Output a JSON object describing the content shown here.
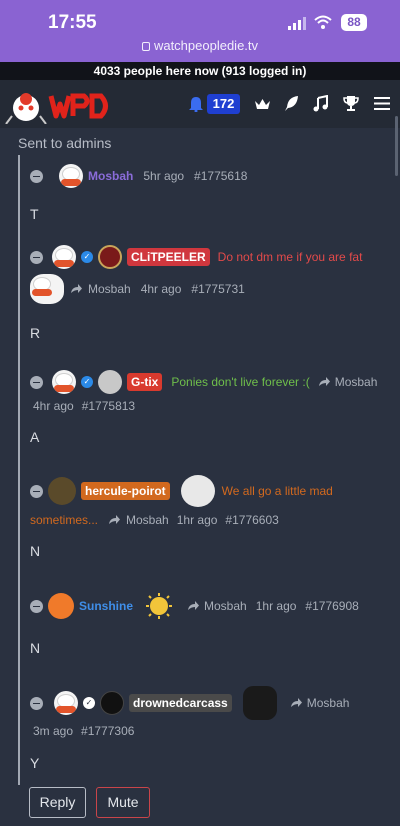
{
  "status_bar": {
    "time": "17:55",
    "battery": "88",
    "url": "watchpeopledie.tv"
  },
  "online_banner": "4033 people here now (913 logged in)",
  "nav": {
    "notification_count": "172",
    "logo_alt": "WPD"
  },
  "section_label": "Sent to admins",
  "comments": [
    {
      "author": "Mosbah",
      "author_color": "#8a6cd8",
      "time": "5hr ago",
      "id": "#1775618",
      "body": "T"
    },
    {
      "author": "CLiTPEELER",
      "pill_color": "#d0373e",
      "status": "Do not dm me if you are fat",
      "status_color": "#e24a4a",
      "reply_to": "Mosbah",
      "time": "4hr ago",
      "id": "#1775731",
      "body": "R"
    },
    {
      "author": "G-tix",
      "pill_color": "#d93a2e",
      "status": "Ponies don't live forever :(",
      "status_color": "#6fbf4b",
      "reply_to": "Mosbah",
      "time": "4hr ago",
      "id": "#1775813",
      "body": "A"
    },
    {
      "author": "hercule-poirot",
      "pill_color": "#d2691e",
      "status": "We all go a little mad",
      "status_cont": "sometimes...",
      "status_color": "#d2691e",
      "reply_to": "Mosbah",
      "time": "1hr ago",
      "id": "#1776603",
      "body": "N"
    },
    {
      "author": "Sunshine",
      "author_color": "#3f8ee8",
      "reply_to": "Mosbah",
      "time": "1hr ago",
      "id": "#1776908",
      "body": "N"
    },
    {
      "author": "drownedcarcass",
      "pill_color": "#4a4a4a",
      "reply_to": "Mosbah",
      "time": "3m ago",
      "id": "#1777306",
      "body": "Y"
    }
  ],
  "actions": {
    "reply": "Reply",
    "mute": "Mute"
  }
}
